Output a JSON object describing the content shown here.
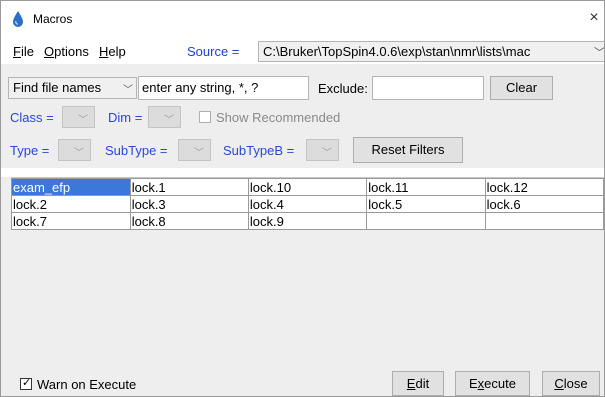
{
  "window": {
    "title": "Macros",
    "close_symbol": "×"
  },
  "menu": {
    "file": {
      "mnemonic": "F",
      "rest": "ile"
    },
    "options": {
      "mnemonic": "O",
      "rest": "ptions"
    },
    "help": {
      "mnemonic": "H",
      "rest": "elp"
    }
  },
  "source": {
    "label": "Source =",
    "value": "C:\\Bruker\\TopSpin4.0.6\\exp\\stan\\nmr\\lists\\mac"
  },
  "search": {
    "mode": "Find file names",
    "query": "enter any string, *, ?",
    "exclude_label": "Exclude:",
    "exclude_value": "",
    "clear_label": "Clear"
  },
  "filters": {
    "class_label": "Class =",
    "dim_label": "Dim =",
    "show_recommended_label": "Show Recommended",
    "type_label": "Type =",
    "subtype_label": "SubType =",
    "subtypeb_label": "SubTypeB =",
    "reset_label": "Reset Filters"
  },
  "files": {
    "rows": [
      [
        "exam_efp",
        "lock.1",
        "lock.10",
        "lock.11",
        "lock.12"
      ],
      [
        "lock.2",
        "lock.3",
        "lock.4",
        "lock.5",
        "lock.6"
      ],
      [
        "lock.7",
        "lock.8",
        "lock.9",
        "",
        ""
      ]
    ],
    "selected": "exam_efp"
  },
  "footer": {
    "warn_label": "Warn on Execute",
    "warn_checked": true,
    "edit": {
      "mnemonic": "E",
      "rest": "dit"
    },
    "execute": {
      "mnemonic": "x",
      "pre": "E",
      "rest": "ecute"
    },
    "close": {
      "mnemonic": "C",
      "rest": "lose"
    }
  },
  "colors": {
    "accent_blue": "#2848d8",
    "selection": "#3b78d8"
  }
}
